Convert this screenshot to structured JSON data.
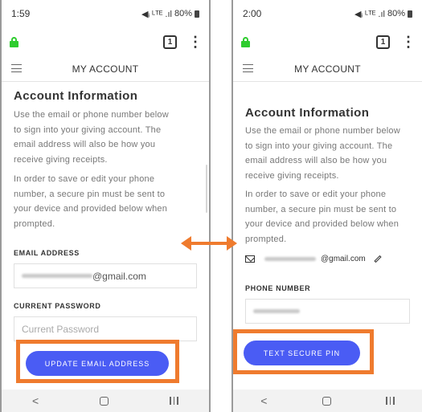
{
  "left": {
    "status": {
      "time": "1:59",
      "signal": "◀ᵢ ᴸᵀᴱ .ıl",
      "battery": "80%"
    },
    "browser": {
      "tab_count": "1"
    },
    "header": {
      "title": "MY ACCOUNT"
    },
    "section_title": "Account Information",
    "para1_lines": [
      "Use the email or phone number below",
      "to sign into your giving account. The",
      "email address will also be how you",
      "receive giving receipts."
    ],
    "para2_lines": [
      "In order to save or edit your phone",
      "number, a secure pin must be sent to",
      "your device and provided below when",
      "prompted."
    ],
    "email_label": "EMAIL ADDRESS",
    "email_domain": "@gmail.com",
    "password_label": "CURRENT PASSWORD",
    "password_placeholder": "Current Password",
    "update_button": "UPDATE EMAIL ADDRESS",
    "nav": {
      "back": "<",
      "recent": "|||"
    }
  },
  "right": {
    "status": {
      "time": "2:00",
      "signal": "◀ᵢ ᴸᵀᴱ .ıl",
      "battery": "80%"
    },
    "browser": {
      "tab_count": "1"
    },
    "header": {
      "title": "MY ACCOUNT"
    },
    "section_title": "Account Information",
    "para1_lines": [
      "Use the email or phone number below",
      "to sign into your giving account. The",
      "email address will also be how you",
      "receive giving receipts."
    ],
    "para2_lines": [
      "In order to save or edit your phone",
      "number, a secure pin must be sent to",
      "your device and provided below when",
      "prompted."
    ],
    "email_domain": "@gmail.com",
    "phone_label": "PHONE NUMBER",
    "text_pin_button": "TEXT SECURE PIN",
    "nav": {
      "back": "<",
      "recent": "|||"
    }
  },
  "colors": {
    "accent": "#4a5cf4",
    "highlight": "#ef7b2e",
    "lock": "#2ecc2e"
  },
  "icons": [
    "lock-icon",
    "tab-switcher-icon",
    "kebab-menu-icon",
    "hamburger-icon",
    "mail-icon",
    "pencil-icon",
    "nav-back-icon",
    "nav-home-icon",
    "nav-recent-icon",
    "double-arrow-icon"
  ]
}
